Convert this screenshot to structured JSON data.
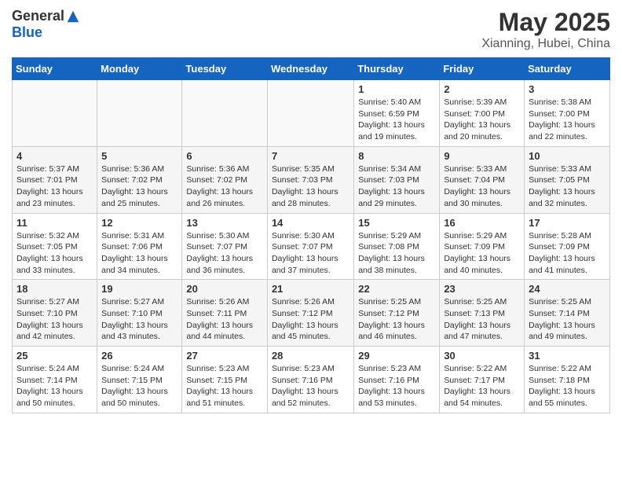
{
  "header": {
    "logo": {
      "general": "General",
      "blue": "Blue"
    },
    "title": "May 2025",
    "subtitle": "Xianning, Hubei, China"
  },
  "days_of_week": [
    "Sunday",
    "Monday",
    "Tuesday",
    "Wednesday",
    "Thursday",
    "Friday",
    "Saturday"
  ],
  "weeks": [
    [
      {
        "day": "",
        "info": ""
      },
      {
        "day": "",
        "info": ""
      },
      {
        "day": "",
        "info": ""
      },
      {
        "day": "",
        "info": ""
      },
      {
        "day": "1",
        "info": "Sunrise: 5:40 AM\nSunset: 6:59 PM\nDaylight: 13 hours\nand 19 minutes."
      },
      {
        "day": "2",
        "info": "Sunrise: 5:39 AM\nSunset: 7:00 PM\nDaylight: 13 hours\nand 20 minutes."
      },
      {
        "day": "3",
        "info": "Sunrise: 5:38 AM\nSunset: 7:00 PM\nDaylight: 13 hours\nand 22 minutes."
      }
    ],
    [
      {
        "day": "4",
        "info": "Sunrise: 5:37 AM\nSunset: 7:01 PM\nDaylight: 13 hours\nand 23 minutes."
      },
      {
        "day": "5",
        "info": "Sunrise: 5:36 AM\nSunset: 7:02 PM\nDaylight: 13 hours\nand 25 minutes."
      },
      {
        "day": "6",
        "info": "Sunrise: 5:36 AM\nSunset: 7:02 PM\nDaylight: 13 hours\nand 26 minutes."
      },
      {
        "day": "7",
        "info": "Sunrise: 5:35 AM\nSunset: 7:03 PM\nDaylight: 13 hours\nand 28 minutes."
      },
      {
        "day": "8",
        "info": "Sunrise: 5:34 AM\nSunset: 7:03 PM\nDaylight: 13 hours\nand 29 minutes."
      },
      {
        "day": "9",
        "info": "Sunrise: 5:33 AM\nSunset: 7:04 PM\nDaylight: 13 hours\nand 30 minutes."
      },
      {
        "day": "10",
        "info": "Sunrise: 5:33 AM\nSunset: 7:05 PM\nDaylight: 13 hours\nand 32 minutes."
      }
    ],
    [
      {
        "day": "11",
        "info": "Sunrise: 5:32 AM\nSunset: 7:05 PM\nDaylight: 13 hours\nand 33 minutes."
      },
      {
        "day": "12",
        "info": "Sunrise: 5:31 AM\nSunset: 7:06 PM\nDaylight: 13 hours\nand 34 minutes."
      },
      {
        "day": "13",
        "info": "Sunrise: 5:30 AM\nSunset: 7:07 PM\nDaylight: 13 hours\nand 36 minutes."
      },
      {
        "day": "14",
        "info": "Sunrise: 5:30 AM\nSunset: 7:07 PM\nDaylight: 13 hours\nand 37 minutes."
      },
      {
        "day": "15",
        "info": "Sunrise: 5:29 AM\nSunset: 7:08 PM\nDaylight: 13 hours\nand 38 minutes."
      },
      {
        "day": "16",
        "info": "Sunrise: 5:29 AM\nSunset: 7:09 PM\nDaylight: 13 hours\nand 40 minutes."
      },
      {
        "day": "17",
        "info": "Sunrise: 5:28 AM\nSunset: 7:09 PM\nDaylight: 13 hours\nand 41 minutes."
      }
    ],
    [
      {
        "day": "18",
        "info": "Sunrise: 5:27 AM\nSunset: 7:10 PM\nDaylight: 13 hours\nand 42 minutes."
      },
      {
        "day": "19",
        "info": "Sunrise: 5:27 AM\nSunset: 7:10 PM\nDaylight: 13 hours\nand 43 minutes."
      },
      {
        "day": "20",
        "info": "Sunrise: 5:26 AM\nSunset: 7:11 PM\nDaylight: 13 hours\nand 44 minutes."
      },
      {
        "day": "21",
        "info": "Sunrise: 5:26 AM\nSunset: 7:12 PM\nDaylight: 13 hours\nand 45 minutes."
      },
      {
        "day": "22",
        "info": "Sunrise: 5:25 AM\nSunset: 7:12 PM\nDaylight: 13 hours\nand 46 minutes."
      },
      {
        "day": "23",
        "info": "Sunrise: 5:25 AM\nSunset: 7:13 PM\nDaylight: 13 hours\nand 47 minutes."
      },
      {
        "day": "24",
        "info": "Sunrise: 5:25 AM\nSunset: 7:14 PM\nDaylight: 13 hours\nand 49 minutes."
      }
    ],
    [
      {
        "day": "25",
        "info": "Sunrise: 5:24 AM\nSunset: 7:14 PM\nDaylight: 13 hours\nand 50 minutes."
      },
      {
        "day": "26",
        "info": "Sunrise: 5:24 AM\nSunset: 7:15 PM\nDaylight: 13 hours\nand 50 minutes."
      },
      {
        "day": "27",
        "info": "Sunrise: 5:23 AM\nSunset: 7:15 PM\nDaylight: 13 hours\nand 51 minutes."
      },
      {
        "day": "28",
        "info": "Sunrise: 5:23 AM\nSunset: 7:16 PM\nDaylight: 13 hours\nand 52 minutes."
      },
      {
        "day": "29",
        "info": "Sunrise: 5:23 AM\nSunset: 7:16 PM\nDaylight: 13 hours\nand 53 minutes."
      },
      {
        "day": "30",
        "info": "Sunrise: 5:22 AM\nSunset: 7:17 PM\nDaylight: 13 hours\nand 54 minutes."
      },
      {
        "day": "31",
        "info": "Sunrise: 5:22 AM\nSunset: 7:18 PM\nDaylight: 13 hours\nand 55 minutes."
      }
    ]
  ]
}
